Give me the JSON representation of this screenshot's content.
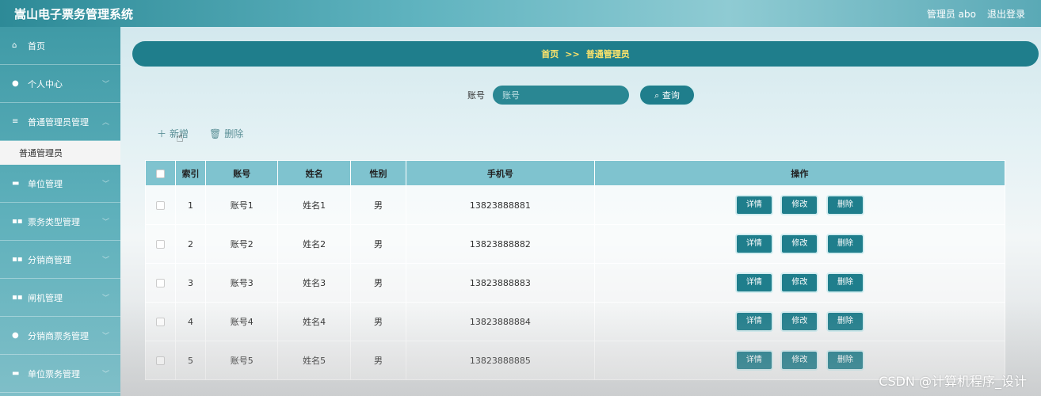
{
  "header": {
    "title": "嵩山电子票务管理系统",
    "user_label": "管理员 abo",
    "logout_label": "退出登录"
  },
  "sidebar": {
    "items": [
      {
        "label": "首页",
        "icon": "home-icon",
        "glyph": "⌂"
      },
      {
        "label": "个人中心",
        "icon": "user-icon",
        "glyph": "●"
      },
      {
        "label": "普通管理员管理",
        "icon": "list-icon",
        "glyph": "≡"
      },
      {
        "label": "单位管理",
        "icon": "monitor-icon",
        "glyph": "▬"
      },
      {
        "label": "票务类型管理",
        "icon": "grid-icon",
        "glyph": "▪▪"
      },
      {
        "label": "分销商管理",
        "icon": "grid-icon",
        "glyph": "▪▪"
      },
      {
        "label": "闸机管理",
        "icon": "grid-icon",
        "glyph": "▪▪"
      },
      {
        "label": "分销商票务管理",
        "icon": "pin-icon",
        "glyph": "●"
      },
      {
        "label": "单位票务管理",
        "icon": "comment-icon",
        "glyph": "▬"
      }
    ],
    "active_sub": "普通管理员"
  },
  "breadcrumb": {
    "home": "首页",
    "sep": ">>",
    "current": "普通管理员"
  },
  "search": {
    "label": "账号",
    "placeholder": "账号",
    "button": "查询",
    "button_icon": "search-icon"
  },
  "actions": {
    "add": "新增",
    "delete": "删除"
  },
  "table": {
    "columns": [
      "索引",
      "账号",
      "姓名",
      "性别",
      "手机号",
      "操作"
    ],
    "rows": [
      {
        "index": "1",
        "account": "账号1",
        "name": "姓名1",
        "gender": "男",
        "phone": "13823888881"
      },
      {
        "index": "2",
        "account": "账号2",
        "name": "姓名2",
        "gender": "男",
        "phone": "13823888882"
      },
      {
        "index": "3",
        "account": "账号3",
        "name": "姓名3",
        "gender": "男",
        "phone": "13823888883"
      },
      {
        "index": "4",
        "account": "账号4",
        "name": "姓名4",
        "gender": "男",
        "phone": "13823888884"
      },
      {
        "index": "5",
        "account": "账号5",
        "name": "姓名5",
        "gender": "男",
        "phone": "13823888885"
      }
    ],
    "row_buttons": {
      "detail": "详情",
      "edit": "修改",
      "delete": "删除"
    }
  },
  "watermark": "CSDN @计算机程序_设计",
  "colors": {
    "accent": "#1f7e8c",
    "breadcrumb_text": "#ffe46a",
    "header_cell": "#7fc3cf"
  }
}
